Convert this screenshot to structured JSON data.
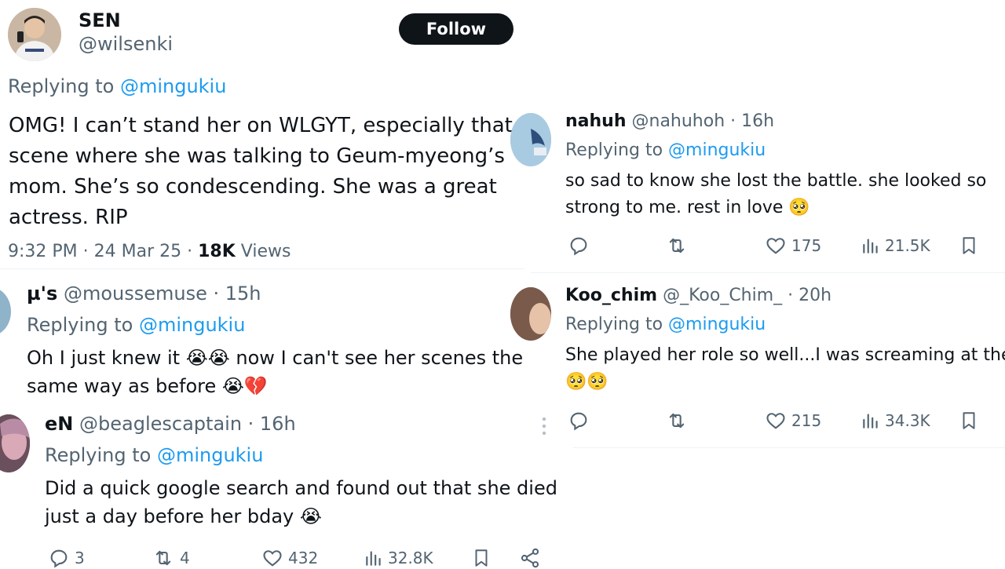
{
  "main_tweet": {
    "name": "SEN",
    "handle": "@wilsenki",
    "follow_label": "Follow",
    "replying_prefix": "Replying to",
    "replying_to": "@mingukiu",
    "text_lines": [
      "OMG! I can’t stand her on WLGYT, especially that",
      "scene where she was talking to Geum-myeong’s",
      "mom. She’s so condescending. She was a great",
      "actress. RIP"
    ],
    "time": "9:32 PM · 24 Mar 25 ·",
    "views_count": "18K",
    "views_label": "Views"
  },
  "reply_mu": {
    "name": "µ's",
    "handle": "@moussemuse · 15h",
    "replying_prefix": "Replying to",
    "replying_to": "@mingukiu",
    "line1": "Oh I just knew it 😭😭 now I can't see her scenes the",
    "line2": "same way as before 😭💔"
  },
  "reply_en": {
    "name": "eN",
    "handle": "@beaglescaptain · 16h",
    "replying_prefix": "Replying to",
    "replying_to": "@mingukiu",
    "line1": "Did a quick google search and found out that she died",
    "line2": "just a day before her bday 😭",
    "replies": "3",
    "retweets": "4",
    "likes": "432",
    "views": "32.8K"
  },
  "reply_nahuh": {
    "name": "nahuh",
    "handle": "@nahuhoh · 16h",
    "replying_prefix": "Replying to",
    "replying_to": "@mingukiu",
    "line1": "so sad to know she lost the battle. she looked so",
    "line2": "strong to me. rest in love 🥺",
    "likes": "175",
    "views": "21.5K"
  },
  "reply_koo": {
    "name": "Koo_chim",
    "handle": "@_Koo_Chim_ · 20h",
    "replying_prefix": "Replying to",
    "replying_to": "@mingukiu",
    "line1": "She played her role so well...I was screaming at the",
    "line2": "🥺🥺",
    "likes": "215",
    "views": "34.3K"
  },
  "colors": {
    "link": "#1d9bf0",
    "muted": "#536471",
    "text": "#0f1419",
    "follow_bg": "#0f1419"
  },
  "icons": [
    "reply-icon",
    "retweet-icon",
    "like-icon",
    "views-icon",
    "bookmark-icon",
    "share-icon",
    "more-icon"
  ]
}
